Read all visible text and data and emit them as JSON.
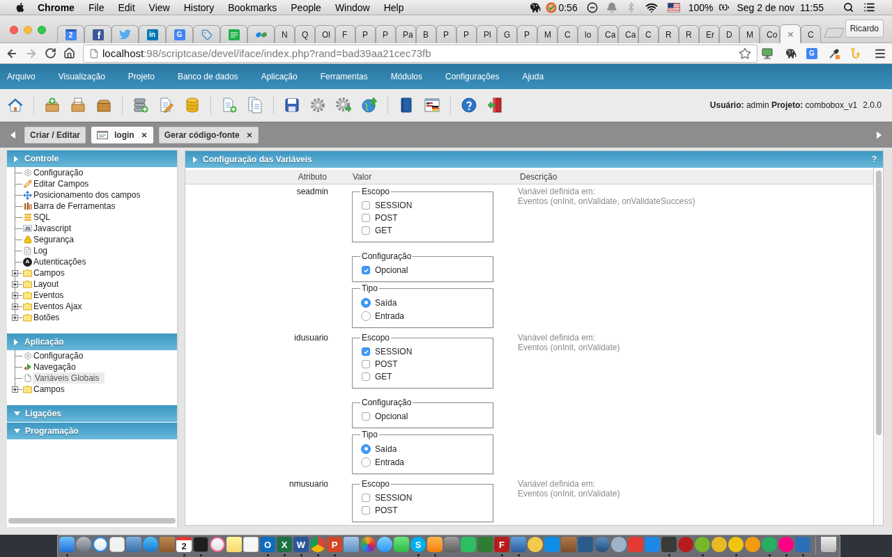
{
  "menubar": {
    "app": "Chrome",
    "menus": [
      "File",
      "Edit",
      "View",
      "History",
      "Bookmarks",
      "People",
      "Window",
      "Help"
    ],
    "timer": "0:56",
    "battery": "100%",
    "date": "Seg 2 de nov",
    "time": "11:55"
  },
  "browser": {
    "tabs": [
      {
        "kind": "icon",
        "icon_text": "2",
        "selected": false
      },
      {
        "kind": "icon",
        "icon_text": "f",
        "selected": false
      },
      {
        "kind": "icon",
        "selected": false
      },
      {
        "kind": "icon",
        "icon_text": "in",
        "selected": false
      },
      {
        "kind": "icon",
        "icon_text": "G",
        "selected": false
      },
      {
        "kind": "icon",
        "selected": false
      },
      {
        "kind": "icon",
        "selected": false
      },
      {
        "kind": "icon",
        "selected": false
      },
      {
        "kind": "page",
        "title": "N",
        "selected": false
      },
      {
        "kind": "page",
        "title": "Q",
        "selected": false
      },
      {
        "kind": "page",
        "title": "Ol",
        "selected": false
      },
      {
        "kind": "page",
        "title": "F",
        "selected": false
      },
      {
        "kind": "page",
        "title": "P",
        "selected": false
      },
      {
        "kind": "page",
        "title": "P",
        "selected": false
      },
      {
        "kind": "page",
        "title": "Pa",
        "selected": false
      },
      {
        "kind": "page",
        "title": "B",
        "selected": false
      },
      {
        "kind": "page",
        "title": "P",
        "selected": false
      },
      {
        "kind": "page",
        "title": "P",
        "selected": false
      },
      {
        "kind": "page",
        "title": "Pl",
        "selected": false
      },
      {
        "kind": "page",
        "title": "G",
        "selected": false
      },
      {
        "kind": "page",
        "title": "P",
        "selected": false
      },
      {
        "kind": "page",
        "title": "M",
        "selected": false
      },
      {
        "kind": "page",
        "title": "C",
        "selected": false
      },
      {
        "kind": "page",
        "title": "lo",
        "selected": false
      },
      {
        "kind": "page",
        "title": "Ca",
        "selected": false
      },
      {
        "kind": "page",
        "title": "Ca",
        "selected": false
      },
      {
        "kind": "page",
        "title": "C",
        "selected": false
      },
      {
        "kind": "page",
        "title": "R",
        "selected": false
      },
      {
        "kind": "page",
        "title": "R",
        "selected": false
      },
      {
        "kind": "page",
        "title": "Er",
        "selected": false
      },
      {
        "kind": "page",
        "title": "D",
        "selected": false
      },
      {
        "kind": "page",
        "title": "M",
        "selected": false
      },
      {
        "kind": "page",
        "title": "Co",
        "selected": false
      },
      {
        "kind": "page",
        "selected": true
      },
      {
        "kind": "page",
        "title": "C",
        "selected": false
      }
    ],
    "profile": "Ricardo",
    "url_host": "localhost",
    "url_path": ":98/scriptcase/devel/iface/index.php?rand=bad39aa21cec73fb",
    "translate_badge": "G"
  },
  "app": {
    "menu": [
      "Arquivo",
      "Visualização",
      "Projeto",
      "Banco de dados",
      "Aplicação",
      "Ferramentas",
      "Módulos",
      "Configurações",
      "Ajuda"
    ],
    "user_info": "**Usuário:** admin **Projeto:** combobox_v1",
    "version": "2.0.0",
    "tabs": [
      {
        "label": "Criar / Editar",
        "kind": "action",
        "selected": false,
        "closable": false
      },
      {
        "label": "login",
        "kind": "app",
        "selected": true,
        "closable": true
      },
      {
        "label": "Gerar código-fonte",
        "kind": "action",
        "selected": false,
        "closable": true
      }
    ]
  },
  "sidebar": {
    "sections": [
      {
        "title": "Controle",
        "expanded": true,
        "items": [
          {
            "label": "Configuração",
            "kind": "config",
            "selected": false
          },
          {
            "label": "Editar Campos",
            "kind": "edit",
            "selected": false
          },
          {
            "label": "Posicionamento dos campos",
            "kind": "position",
            "selected": false
          },
          {
            "label": "Barra de Ferramentas",
            "kind": "toolbar",
            "selected": false
          },
          {
            "label": "SQL",
            "kind": "sql",
            "selected": false
          },
          {
            "label": "Javascript",
            "kind": "script",
            "badge": "JS",
            "selected": false
          },
          {
            "label": "Segurança",
            "kind": "security",
            "selected": false
          },
          {
            "label": "Log",
            "kind": "log",
            "selected": false
          },
          {
            "label": "Autenticações",
            "kind": "auth",
            "badge": "A",
            "selected": false
          },
          {
            "label": "Campos",
            "kind": "folder",
            "expanded": false,
            "selected": false
          },
          {
            "label": "Layout",
            "kind": "folder",
            "expanded": false,
            "selected": false
          },
          {
            "label": "Eventos",
            "kind": "folder",
            "expanded": false,
            "selected": false
          },
          {
            "label": "Eventos Ajax",
            "kind": "folder",
            "expanded": false,
            "selected": false
          },
          {
            "label": "Botões",
            "kind": "folder",
            "expanded": false,
            "selected": false
          }
        ]
      },
      {
        "title": "Aplicação",
        "expanded": true,
        "items": [
          {
            "label": "Configuração",
            "kind": "config",
            "selected": false
          },
          {
            "label": "Navegação",
            "kind": "navigation",
            "selected": false
          },
          {
            "label": "Variáveis Globais",
            "kind": "variables",
            "selected": true
          },
          {
            "label": "Campos",
            "kind": "folder",
            "expanded": false,
            "selected": false
          }
        ]
      },
      {
        "title": "Ligações",
        "expanded": false
      },
      {
        "title": "Programação",
        "expanded": false
      }
    ]
  },
  "panel": {
    "title": "Configuração das Variáveis",
    "help": "?",
    "columns": [
      "Atributo",
      "Valor",
      "Descrição"
    ],
    "variables": [
      {
        "name": "seadmin",
        "groups": [
          {
            "legend": "Escopo",
            "kind": "checkbox",
            "options": [
              {
                "label": "SESSION",
                "checked": false
              },
              {
                "label": "POST",
                "checked": false
              },
              {
                "label": "GET",
                "checked": false
              }
            ]
          },
          {
            "legend": "Configuração",
            "kind": "checkbox",
            "options": [
              {
                "label": "Opcional",
                "checked": true
              }
            ]
          },
          {
            "legend": "Tipo",
            "kind": "radio",
            "options": [
              {
                "label": "Saída",
                "selected": true
              },
              {
                "label": "Entrada",
                "selected": false
              }
            ]
          }
        ],
        "description": [
          "Variável definida em:",
          "Eventos (onInit, onValidate, onValidateSuccess)"
        ]
      },
      {
        "name": "idusuario",
        "groups": [
          {
            "legend": "Escopo",
            "kind": "checkbox",
            "options": [
              {
                "label": "SESSION",
                "checked": true
              },
              {
                "label": "POST",
                "checked": false
              },
              {
                "label": "GET",
                "checked": false
              }
            ]
          },
          {
            "legend": "Configuração",
            "kind": "checkbox",
            "options": [
              {
                "label": "Opcional",
                "checked": false
              }
            ]
          },
          {
            "legend": "Tipo",
            "kind": "radio",
            "options": [
              {
                "label": "Saída",
                "selected": true
              },
              {
                "label": "Entrada",
                "selected": false
              }
            ]
          }
        ],
        "description": [
          "Variável definida em:",
          "Eventos (onInit, onValidate)"
        ]
      },
      {
        "name": "nmusuario",
        "groups": [
          {
            "legend": "Escopo",
            "kind": "checkbox",
            "options": [
              {
                "label": "SESSION",
                "checked": false
              },
              {
                "label": "POST",
                "checked": false
              }
            ]
          }
        ],
        "description": [
          "Variável definida em:",
          "Eventos (onInit, onValidate)"
        ]
      }
    ]
  },
  "dock": [
    {
      "running": true
    },
    {
      "running": false
    },
    {
      "running": false
    },
    {
      "running": false
    },
    {
      "running": false
    },
    {
      "running": false
    },
    {
      "running": false
    },
    {
      "label": "2",
      "running": true
    },
    {
      "running": true
    },
    {
      "running": false
    },
    {
      "running": false
    },
    {
      "running": false
    },
    {
      "label": "O",
      "running": true
    },
    {
      "label": "X",
      "running": true
    },
    {
      "label": "W",
      "running": true
    },
    {
      "running": true
    },
    {
      "label": "P",
      "running": true
    },
    {
      "running": false
    },
    {
      "running": false
    },
    {
      "running": false
    },
    {
      "running": false
    },
    {
      "label": "S",
      "running": true
    },
    {
      "running": true
    },
    {
      "running": false
    },
    {
      "running": false
    },
    {
      "running": false
    },
    {
      "label": "F",
      "running": true
    },
    {
      "running": true
    },
    {
      "running": false
    },
    {
      "running": false
    },
    {
      "running": false
    },
    {
      "running": false
    },
    {
      "running": false
    },
    {
      "running": false
    },
    {
      "running": false
    },
    {
      "running": false
    },
    {
      "running": true
    },
    {
      "running": false
    },
    {
      "running": true
    },
    {
      "running": false
    },
    {
      "running": true
    },
    {
      "running": false
    },
    {
      "running": true
    },
    {
      "running": true
    },
    {
      "running": true
    },
    {
      "running": false
    }
  ]
}
